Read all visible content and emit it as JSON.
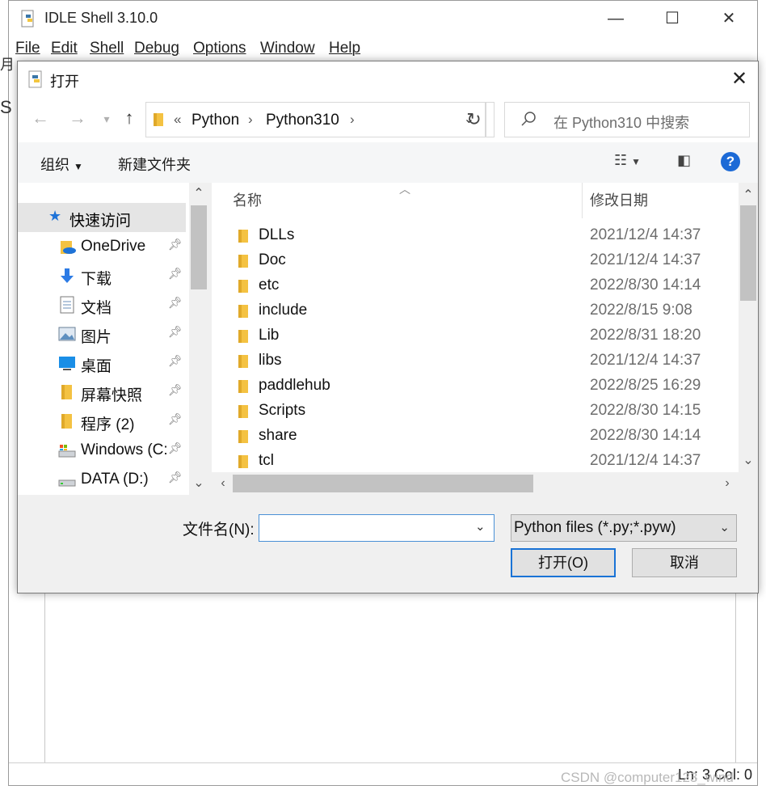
{
  "idle": {
    "title": "IDLE Shell 3.10.0",
    "menu": [
      "File",
      "Edit",
      "Shell",
      "Debug",
      "Options",
      "Window",
      "Help"
    ],
    "status": "Ln: 3   Col: 0",
    "left_fragments": [
      "月",
      "S"
    ]
  },
  "watermark": "CSDN @computer123_wind",
  "dialog": {
    "title": "打开",
    "address": {
      "prefix": "«",
      "crumbs": [
        "Python",
        "Python310"
      ]
    },
    "search_placeholder": "在 Python310 中搜索",
    "commands": {
      "organize": "组织",
      "new_folder": "新建文件夹"
    },
    "nav_pane": {
      "quick_access": "快速访问",
      "items": [
        {
          "label": "OneDrive",
          "icon": "onedrive-icon"
        },
        {
          "label": "下载",
          "icon": "download-icon"
        },
        {
          "label": "文档",
          "icon": "document-icon"
        },
        {
          "label": "图片",
          "icon": "pictures-icon"
        },
        {
          "label": "桌面",
          "icon": "desktop-icon"
        },
        {
          "label": "屏幕快照",
          "icon": "folder-icon"
        },
        {
          "label": "程序 (2)",
          "icon": "folder-icon"
        },
        {
          "label": "Windows (C:",
          "icon": "drive-icon"
        },
        {
          "label": "DATA (D:)",
          "icon": "drive-icon"
        }
      ]
    },
    "columns": {
      "name": "名称",
      "date": "修改日期"
    },
    "files": [
      {
        "name": "DLLs",
        "date": "2021/12/4 14:37"
      },
      {
        "name": "Doc",
        "date": "2021/12/4 14:37"
      },
      {
        "name": "etc",
        "date": "2022/8/30 14:14"
      },
      {
        "name": "include",
        "date": "2022/8/15 9:08"
      },
      {
        "name": "Lib",
        "date": "2022/8/31 18:20"
      },
      {
        "name": "libs",
        "date": "2021/12/4 14:37"
      },
      {
        "name": "paddlehub",
        "date": "2022/8/25 16:29"
      },
      {
        "name": "Scripts",
        "date": "2022/8/30 14:15"
      },
      {
        "name": "share",
        "date": "2022/8/30 14:14"
      },
      {
        "name": "tcl",
        "date": "2021/12/4 14:37"
      }
    ],
    "filename_label": "文件名(N):",
    "filename_value": "",
    "file_type": "Python files (*.py;*.pyw)",
    "open_button": "打开(O)",
    "cancel_button": "取消"
  },
  "colors": {
    "accent": "#1a73d6",
    "folder": "#f4c242",
    "selection": "#e5e5e5"
  }
}
